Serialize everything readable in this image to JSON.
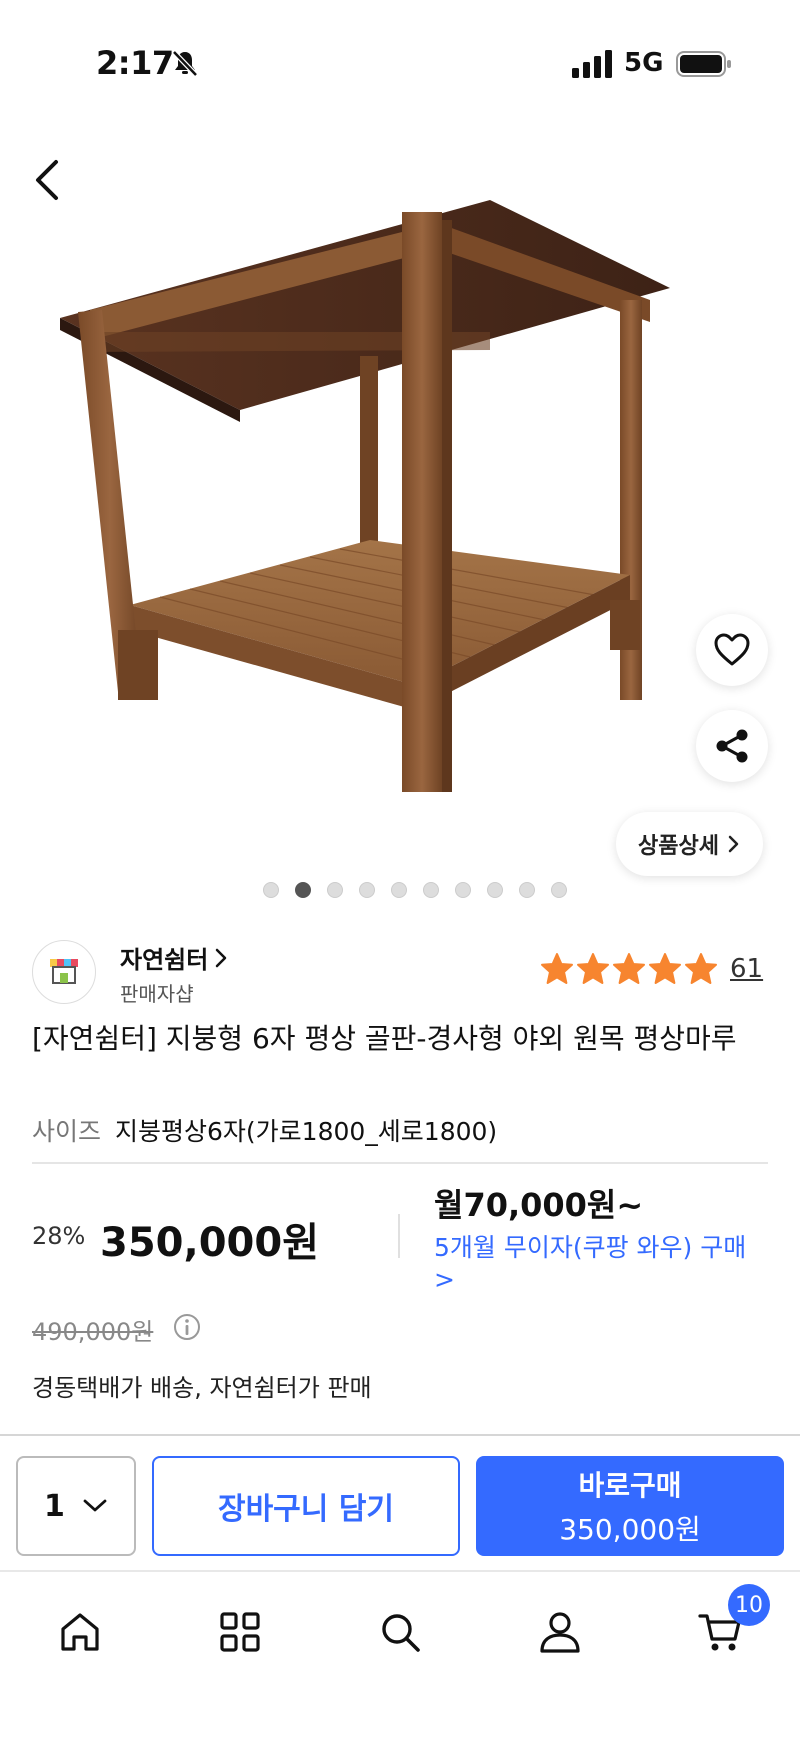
{
  "status_bar": {
    "time": "2:17",
    "network": "5G"
  },
  "hero": {
    "detail_button": "상품상세",
    "image_count": 10,
    "active_image": 2
  },
  "seller": {
    "name": "자연쉼터",
    "subtitle": "판매자샵"
  },
  "rating": {
    "stars": 5,
    "review_count": "61"
  },
  "product": {
    "title": "[자연쉼터] 지붕형 6자 평상 골판-경사형 야외 원목 평상마루",
    "option_label": "사이즈",
    "option_value": "지붕평상6자(가로1800_세로1800)"
  },
  "price": {
    "discount": "28%",
    "sale_price": "350,000원",
    "monthly": "월70,000원~",
    "installment": "5개월 무이자(쿠팡 와우) 구매 >",
    "original_price": "490,000원",
    "shipping": "경동택배가 배송, 자연쉼터가 판매"
  },
  "purchase_bar": {
    "quantity": "1",
    "cart_button": "장바구니 담기",
    "buy_button": "바로구매",
    "buy_price": "350,000원"
  },
  "tab_bar": {
    "cart_badge": "10"
  },
  "colors": {
    "accent": "#346aff",
    "star": "#f7852f",
    "wood": "#8a5a34"
  }
}
